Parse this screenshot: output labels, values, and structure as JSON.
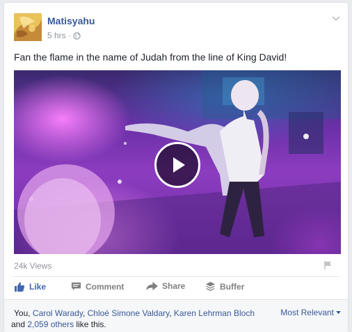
{
  "post": {
    "author": "Matisyahu",
    "time": "5 hrs",
    "separator": "·",
    "text": "Fan the flame in the name of Judah from the line of King David!",
    "privacy_icon": "globe-icon",
    "menu_icon": "chevron-down-icon"
  },
  "video": {
    "views": "24k Views",
    "play_icon": "play-icon",
    "report_icon": "flag-icon"
  },
  "actions": {
    "like": "Like",
    "comment": "Comment",
    "share": "Share",
    "buffer": "Buffer"
  },
  "reactions": {
    "you": "You",
    "comma1": ", ",
    "name1": "Carol Warady",
    "comma2": ", ",
    "name2": "Chloé Simone Valdary",
    "comma3": ", ",
    "name3": "Karen Lehrman Bloch",
    "and": " and ",
    "others": "2,059 others",
    "suffix": " like this.",
    "sort_label": "Most Relevant"
  },
  "colors": {
    "link": "#365899",
    "like_active": "#4267b2",
    "muted": "#90949c"
  }
}
